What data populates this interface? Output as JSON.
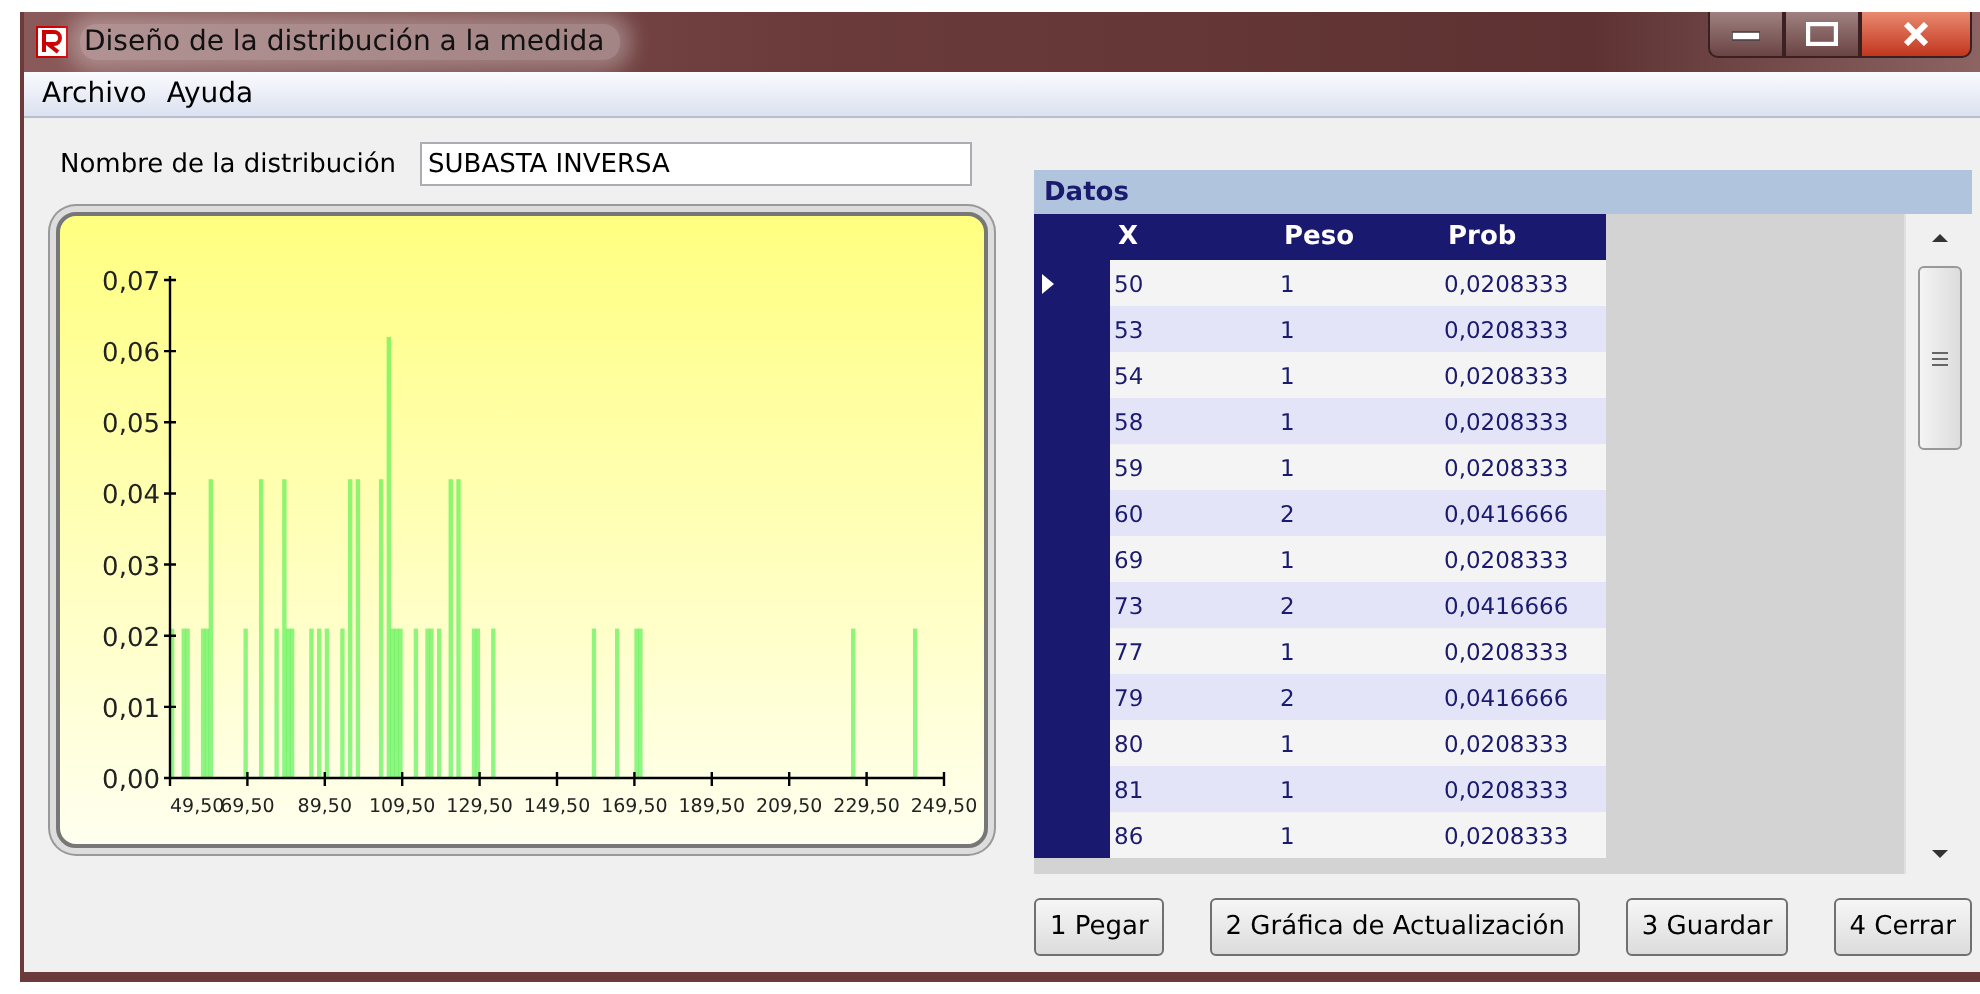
{
  "window": {
    "title": "Diseño de la distribución a la medida"
  },
  "menu": [
    "Archivo",
    "Ayuda"
  ],
  "name_field": {
    "label": "Nombre de la distribución",
    "value": "SUBASTA INVERSA"
  },
  "chart": {
    "chart_data": {
      "type": "bar",
      "x": [
        50,
        53,
        54,
        58,
        59,
        60,
        69,
        73,
        77,
        79,
        80,
        81,
        86,
        88,
        90,
        94,
        96,
        98,
        104,
        106,
        107,
        108,
        109,
        113,
        116,
        117,
        119,
        122,
        124,
        128,
        129,
        133,
        159,
        165,
        170,
        171,
        226,
        242
      ],
      "values": [
        0.021,
        0.021,
        0.021,
        0.021,
        0.021,
        0.042,
        0.021,
        0.042,
        0.021,
        0.042,
        0.021,
        0.021,
        0.021,
        0.021,
        0.021,
        0.021,
        0.042,
        0.042,
        0.042,
        0.062,
        0.021,
        0.021,
        0.021,
        0.021,
        0.021,
        0.021,
        0.021,
        0.042,
        0.042,
        0.021,
        0.021,
        0.021,
        0.021,
        0.021,
        0.021,
        0.021,
        0.021,
        0.021
      ],
      "xlim": [
        49.5,
        249.5
      ],
      "ylim": [
        0,
        0.07
      ],
      "xticks": [
        {
          "value": 49.5,
          "label": "49,50"
        },
        {
          "value": 69.5,
          "label": "69,50"
        },
        {
          "value": 89.5,
          "label": "89,50"
        },
        {
          "value": 109.5,
          "label": "109,50"
        },
        {
          "value": 129.5,
          "label": "129,50"
        },
        {
          "value": 149.5,
          "label": "149,50"
        },
        {
          "value": 169.5,
          "label": "169,50"
        },
        {
          "value": 189.5,
          "label": "189,50"
        },
        {
          "value": 209.5,
          "label": "209,50"
        },
        {
          "value": 229.5,
          "label": "229,50"
        },
        {
          "value": 249.5,
          "label": "249,50"
        }
      ],
      "yticks": [
        {
          "value": 0,
          "label": "0,00"
        },
        {
          "value": 0.01,
          "label": "0,01"
        },
        {
          "value": 0.02,
          "label": "0,02"
        },
        {
          "value": 0.03,
          "label": "0,03"
        },
        {
          "value": 0.04,
          "label": "0,04"
        },
        {
          "value": 0.05,
          "label": "0,05"
        },
        {
          "value": 0.06,
          "label": "0,06"
        },
        {
          "value": 0.07,
          "label": "0,07"
        }
      ]
    }
  },
  "data_grid": {
    "title": "Datos",
    "columns": [
      "X",
      "Peso",
      "Prob"
    ],
    "rows": [
      {
        "cells": [
          "50",
          "1",
          "0,0208333"
        ],
        "selected": true
      },
      {
        "cells": [
          "53",
          "1",
          "0,0208333"
        ],
        "selected": false
      },
      {
        "cells": [
          "54",
          "1",
          "0,0208333"
        ],
        "selected": false
      },
      {
        "cells": [
          "58",
          "1",
          "0,0208333"
        ],
        "selected": false
      },
      {
        "cells": [
          "59",
          "1",
          "0,0208333"
        ],
        "selected": false
      },
      {
        "cells": [
          "60",
          "2",
          "0,0416666"
        ],
        "selected": false
      },
      {
        "cells": [
          "69",
          "1",
          "0,0208333"
        ],
        "selected": false
      },
      {
        "cells": [
          "73",
          "2",
          "0,0416666"
        ],
        "selected": false
      },
      {
        "cells": [
          "77",
          "1",
          "0,0208333"
        ],
        "selected": false
      },
      {
        "cells": [
          "79",
          "2",
          "0,0416666"
        ],
        "selected": false
      },
      {
        "cells": [
          "80",
          "1",
          "0,0208333"
        ],
        "selected": false
      },
      {
        "cells": [
          "81",
          "1",
          "0,0208333"
        ],
        "selected": false
      },
      {
        "cells": [
          "86",
          "1",
          "0,0208333"
        ],
        "selected": false
      }
    ]
  },
  "buttons": [
    "1 Pegar",
    "2 Gráfica de Actualización",
    "3 Guardar",
    "4 Cerrar"
  ]
}
